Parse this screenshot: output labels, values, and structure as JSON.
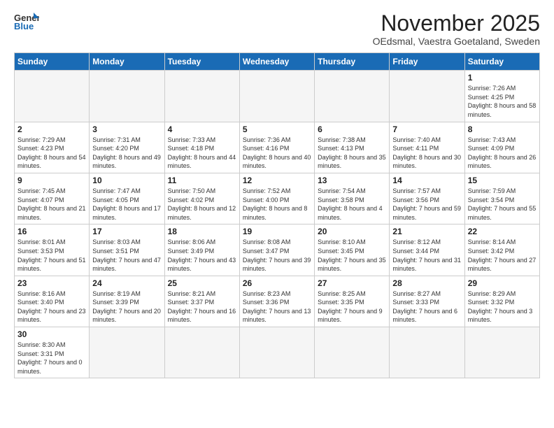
{
  "logo": {
    "text_general": "General",
    "text_blue": "Blue"
  },
  "header": {
    "title": "November 2025",
    "subtitle": "OEdsmal, Vaestra Goetaland, Sweden"
  },
  "days_of_week": [
    "Sunday",
    "Monday",
    "Tuesday",
    "Wednesday",
    "Thursday",
    "Friday",
    "Saturday"
  ],
  "weeks": [
    [
      {
        "day": "",
        "info": ""
      },
      {
        "day": "",
        "info": ""
      },
      {
        "day": "",
        "info": ""
      },
      {
        "day": "",
        "info": ""
      },
      {
        "day": "",
        "info": ""
      },
      {
        "day": "",
        "info": ""
      },
      {
        "day": "1",
        "info": "Sunrise: 7:26 AM\nSunset: 4:25 PM\nDaylight: 8 hours and 58 minutes."
      }
    ],
    [
      {
        "day": "2",
        "info": "Sunrise: 7:29 AM\nSunset: 4:23 PM\nDaylight: 8 hours and 54 minutes."
      },
      {
        "day": "3",
        "info": "Sunrise: 7:31 AM\nSunset: 4:20 PM\nDaylight: 8 hours and 49 minutes."
      },
      {
        "day": "4",
        "info": "Sunrise: 7:33 AM\nSunset: 4:18 PM\nDaylight: 8 hours and 44 minutes."
      },
      {
        "day": "5",
        "info": "Sunrise: 7:36 AM\nSunset: 4:16 PM\nDaylight: 8 hours and 40 minutes."
      },
      {
        "day": "6",
        "info": "Sunrise: 7:38 AM\nSunset: 4:13 PM\nDaylight: 8 hours and 35 minutes."
      },
      {
        "day": "7",
        "info": "Sunrise: 7:40 AM\nSunset: 4:11 PM\nDaylight: 8 hours and 30 minutes."
      },
      {
        "day": "8",
        "info": "Sunrise: 7:43 AM\nSunset: 4:09 PM\nDaylight: 8 hours and 26 minutes."
      }
    ],
    [
      {
        "day": "9",
        "info": "Sunrise: 7:45 AM\nSunset: 4:07 PM\nDaylight: 8 hours and 21 minutes."
      },
      {
        "day": "10",
        "info": "Sunrise: 7:47 AM\nSunset: 4:05 PM\nDaylight: 8 hours and 17 minutes."
      },
      {
        "day": "11",
        "info": "Sunrise: 7:50 AM\nSunset: 4:02 PM\nDaylight: 8 hours and 12 minutes."
      },
      {
        "day": "12",
        "info": "Sunrise: 7:52 AM\nSunset: 4:00 PM\nDaylight: 8 hours and 8 minutes."
      },
      {
        "day": "13",
        "info": "Sunrise: 7:54 AM\nSunset: 3:58 PM\nDaylight: 8 hours and 4 minutes."
      },
      {
        "day": "14",
        "info": "Sunrise: 7:57 AM\nSunset: 3:56 PM\nDaylight: 7 hours and 59 minutes."
      },
      {
        "day": "15",
        "info": "Sunrise: 7:59 AM\nSunset: 3:54 PM\nDaylight: 7 hours and 55 minutes."
      }
    ],
    [
      {
        "day": "16",
        "info": "Sunrise: 8:01 AM\nSunset: 3:53 PM\nDaylight: 7 hours and 51 minutes."
      },
      {
        "day": "17",
        "info": "Sunrise: 8:03 AM\nSunset: 3:51 PM\nDaylight: 7 hours and 47 minutes."
      },
      {
        "day": "18",
        "info": "Sunrise: 8:06 AM\nSunset: 3:49 PM\nDaylight: 7 hours and 43 minutes."
      },
      {
        "day": "19",
        "info": "Sunrise: 8:08 AM\nSunset: 3:47 PM\nDaylight: 7 hours and 39 minutes."
      },
      {
        "day": "20",
        "info": "Sunrise: 8:10 AM\nSunset: 3:45 PM\nDaylight: 7 hours and 35 minutes."
      },
      {
        "day": "21",
        "info": "Sunrise: 8:12 AM\nSunset: 3:44 PM\nDaylight: 7 hours and 31 minutes."
      },
      {
        "day": "22",
        "info": "Sunrise: 8:14 AM\nSunset: 3:42 PM\nDaylight: 7 hours and 27 minutes."
      }
    ],
    [
      {
        "day": "23",
        "info": "Sunrise: 8:16 AM\nSunset: 3:40 PM\nDaylight: 7 hours and 23 minutes."
      },
      {
        "day": "24",
        "info": "Sunrise: 8:19 AM\nSunset: 3:39 PM\nDaylight: 7 hours and 20 minutes."
      },
      {
        "day": "25",
        "info": "Sunrise: 8:21 AM\nSunset: 3:37 PM\nDaylight: 7 hours and 16 minutes."
      },
      {
        "day": "26",
        "info": "Sunrise: 8:23 AM\nSunset: 3:36 PM\nDaylight: 7 hours and 13 minutes."
      },
      {
        "day": "27",
        "info": "Sunrise: 8:25 AM\nSunset: 3:35 PM\nDaylight: 7 hours and 9 minutes."
      },
      {
        "day": "28",
        "info": "Sunrise: 8:27 AM\nSunset: 3:33 PM\nDaylight: 7 hours and 6 minutes."
      },
      {
        "day": "29",
        "info": "Sunrise: 8:29 AM\nSunset: 3:32 PM\nDaylight: 7 hours and 3 minutes."
      }
    ],
    [
      {
        "day": "30",
        "info": "Sunrise: 8:30 AM\nSunset: 3:31 PM\nDaylight: 7 hours and 0 minutes."
      },
      {
        "day": "",
        "info": ""
      },
      {
        "day": "",
        "info": ""
      },
      {
        "day": "",
        "info": ""
      },
      {
        "day": "",
        "info": ""
      },
      {
        "day": "",
        "info": ""
      },
      {
        "day": "",
        "info": ""
      }
    ]
  ]
}
